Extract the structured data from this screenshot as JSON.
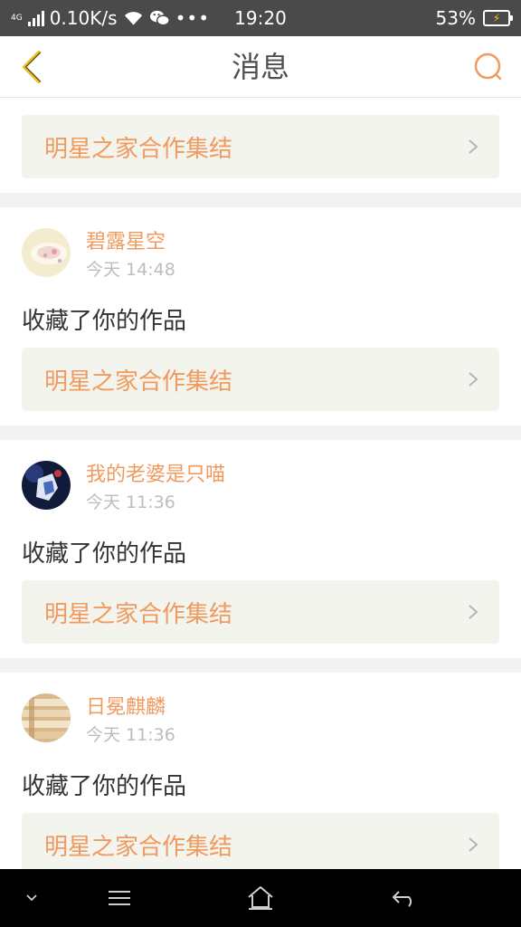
{
  "status_bar": {
    "network_type": "4G",
    "speed": "0.10K/s",
    "time": "19:20",
    "battery": "53%"
  },
  "header": {
    "title": "消息",
    "back_icon": "chevron-left-icon",
    "search_icon": "search-icon"
  },
  "top_card": {
    "link_text": "明星之家合作集结"
  },
  "messages": [
    {
      "username": "碧露星空",
      "time": "今天 14:48",
      "action": "收藏了你的作品",
      "link_text": "明星之家合作集结"
    },
    {
      "username": "我的老婆是只喵",
      "time": "今天 11:36",
      "action": "收藏了你的作品",
      "link_text": "明星之家合作集结"
    },
    {
      "username": "日冕麒麟",
      "time": "今天 11:36",
      "action": "收藏了你的作品",
      "link_text": "明星之家合作集结"
    }
  ],
  "colors": {
    "accent": "#f09a5e",
    "status_bar": "#4a4a4a",
    "link_box": "#f4f4ee",
    "back_arrow": "#e6c21e"
  },
  "nav": {
    "items": [
      "collapse-icon",
      "menu-icon",
      "home-icon",
      "back-icon"
    ]
  }
}
